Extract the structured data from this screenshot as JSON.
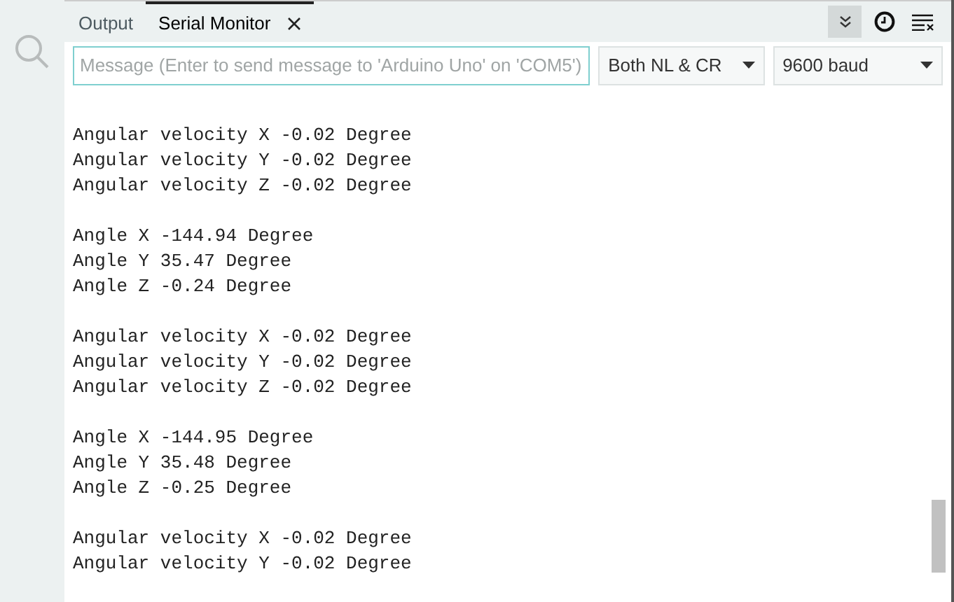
{
  "tabs": [
    {
      "label": "Output",
      "selected": false,
      "closable": false
    },
    {
      "label": "Serial Monitor",
      "selected": true,
      "closable": true
    }
  ],
  "toolbar": {
    "autoscroll_on": true
  },
  "message_field": {
    "placeholder": "Message (Enter to send message to 'Arduino Uno' on 'COM5')"
  },
  "line_ending": {
    "value": "Both NL & CR"
  },
  "baud_rate": {
    "value": "9600 baud"
  },
  "output_groups": [
    {
      "lines": [
        "Angular velocity X -0.02 Degree",
        "Angular velocity Y -0.02 Degree",
        "Angular velocity Z -0.02 Degree"
      ]
    },
    {
      "lines": [
        "Angle X -144.94 Degree",
        "Angle Y 35.47 Degree",
        "Angle Z -0.24 Degree"
      ]
    },
    {
      "lines": [
        "Angular velocity X -0.02 Degree",
        "Angular velocity Y -0.02 Degree",
        "Angular velocity Z -0.02 Degree"
      ]
    },
    {
      "lines": [
        "Angle X -144.95 Degree",
        "Angle Y 35.48 Degree",
        "Angle Z -0.25 Degree"
      ]
    },
    {
      "lines": [
        "Angular velocity X -0.02 Degree",
        "Angular velocity Y -0.02 Degree"
      ]
    }
  ]
}
